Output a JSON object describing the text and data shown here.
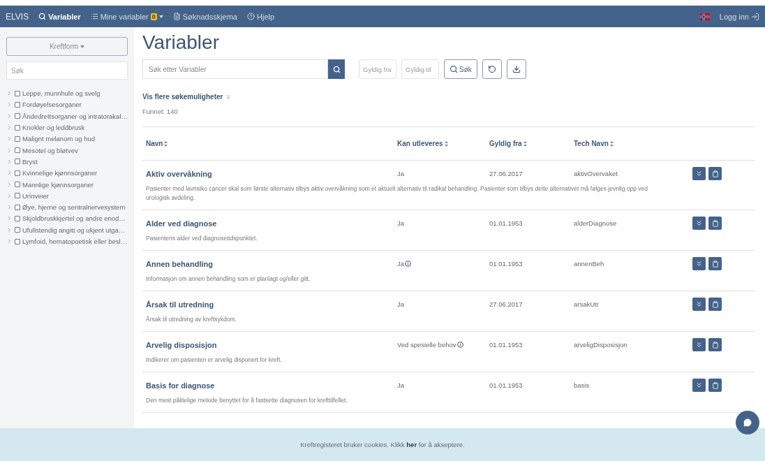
{
  "navbar": {
    "brand": "ELVIS",
    "items": [
      {
        "kind": "search",
        "label": "Variabler",
        "selected": true
      },
      {
        "kind": "list",
        "label": "Mine variabler",
        "badge": "0",
        "selected": false
      },
      {
        "kind": "form",
        "label": "Søknadsskjema",
        "selected": false
      },
      {
        "kind": "help",
        "label": "Hjelp",
        "selected": false
      }
    ],
    "login": "Logg inn"
  },
  "sidebar": {
    "dropdown": "Kreftform",
    "search": {
      "placeholder": "Søk"
    },
    "items": [
      {
        "label": "Leppe, munnhule og svelg",
        "checked": false
      },
      {
        "label": "Fordøyelsesorganer",
        "checked": false
      },
      {
        "label": "Åndedrettsorganer og intratorakal…",
        "checked": false
      },
      {
        "label": "Knokler og leddbrusk",
        "checked": false
      },
      {
        "label": "Malignt melanom og hud",
        "checked": false
      },
      {
        "label": "Mesotel og bløtvev",
        "checked": false
      },
      {
        "label": "Bryst",
        "checked": false
      },
      {
        "label": "Kvinnelige kjønnsorganer",
        "checked": false
      },
      {
        "label": "Mannlige kjønnsorganer",
        "checked": false
      },
      {
        "label": "Urinveier",
        "checked": false
      },
      {
        "label": "Øye, hjerne og sentralnervesystem",
        "checked": false
      },
      {
        "label": "Skjoldbruskkjertel og andre enod…",
        "checked": false
      },
      {
        "label": "Ufullstendig angitt og ukjent utga…",
        "checked": false
      },
      {
        "label": "Lymfoid, hematopoetisk eller besl…",
        "checked": false
      }
    ]
  },
  "main": {
    "title": "Variabler",
    "search": {
      "placeholder": "Søk etter Variabler"
    },
    "valid_from": {
      "placeholder": "Gyldig fra"
    },
    "valid_to": {
      "placeholder": "Gyldig til"
    },
    "search_button": "Søk",
    "more_options": "Vis flere søkemuligheter",
    "found": "Funnet: 140",
    "table": {
      "columns": [
        "Navn",
        "Kan utleveres",
        "Gyldig fra",
        "Tech Navn"
      ],
      "rows": [
        {
          "name": "Aktiv overvåkning",
          "release": "Ja",
          "info": false,
          "valid_from": "27.06.2017",
          "tech_name": "aktivOvervaket",
          "description": "Pasienter med lavrisiko cancer skal som første alternativ tilbys aktiv overvåkning som et aktuelt alternativ til radikal behandling. Pasienter som tilbys dette alternativet må følges jevnlig opp ved urologisk avdeling."
        },
        {
          "name": "Alder ved diagnose",
          "release": "Ja",
          "info": false,
          "valid_from": "01.01.1953",
          "tech_name": "alderDiagnose",
          "description": "Pasientens alder ved diagnosetidspunktet."
        },
        {
          "name": "Annen behandling",
          "release": "Ja",
          "info": true,
          "valid_from": "01.01.1953",
          "tech_name": "annenBeh",
          "description": "Informasjon om annen behandling som er planlagt og/eller gitt."
        },
        {
          "name": "Årsak til utredning",
          "release": "Ja",
          "info": false,
          "valid_from": "27.06.2017",
          "tech_name": "arsakUtr",
          "description": "Årsak til utredning av kreftsykdom."
        },
        {
          "name": "Arvelig disposisjon",
          "release": "Ved spesielle behov",
          "info": true,
          "valid_from": "01.01.1953",
          "tech_name": "arveligDisposisjon",
          "description": "Indikerer om pasienten er arvelig disponert for kreft."
        },
        {
          "name": "Basis for diagnose",
          "release": "Ja",
          "info": false,
          "valid_from": "01.01.1953",
          "tech_name": "basis",
          "description": "Den mest pålitelige metode benyttet for å fastsette diagnosen for krefttilfellet."
        }
      ]
    }
  },
  "cookie_banner": {
    "text": "Kreftregisteret bruker cookies. Klikk ",
    "link": "her",
    "after": " for å akseptere."
  }
}
